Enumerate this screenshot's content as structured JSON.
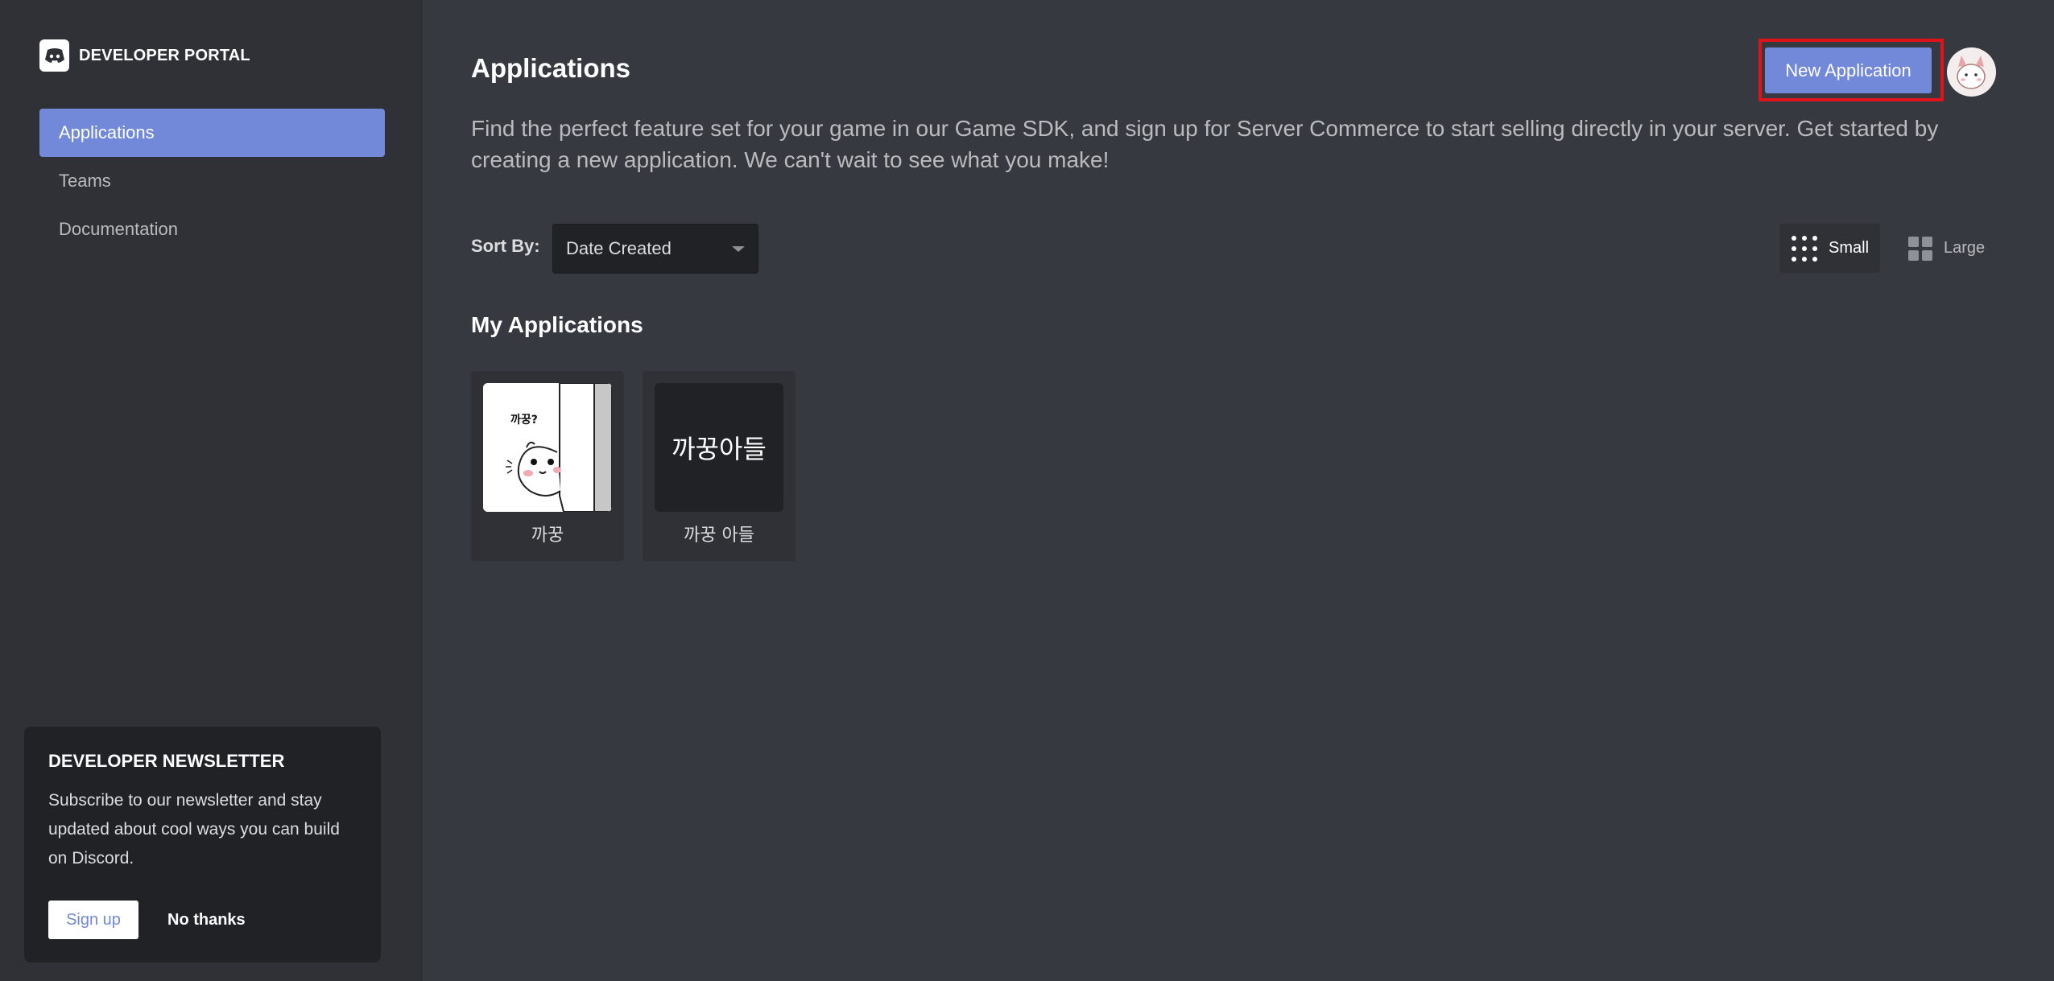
{
  "sidebar": {
    "brand": "DEVELOPER PORTAL",
    "items": [
      {
        "label": "Applications"
      },
      {
        "label": "Teams"
      },
      {
        "label": "Documentation"
      }
    ],
    "newsletter": {
      "title": "DEVELOPER NEWSLETTER",
      "body": "Subscribe to our newsletter and stay updated about cool ways you can build on Discord.",
      "signup_label": "Sign up",
      "nothanks_label": "No thanks"
    }
  },
  "header": {
    "title": "Applications",
    "description": "Find the perfect feature set for your game in our Game SDK, and sign up for Server Commerce to start selling directly in your server. Get started by creating a new application. We can't wait to see what you make!",
    "new_app_label": "New Application"
  },
  "toolbar": {
    "sort_label": "Sort By:",
    "sort_value": "Date Created",
    "view_small_label": "Small",
    "view_large_label": "Large"
  },
  "applications": {
    "section_title": "My Applications",
    "items": [
      {
        "name": "까꿍",
        "thumb_caption": "까꿍?",
        "icon": "peeking-character-image"
      },
      {
        "name": "까꿍 아들",
        "thumb_text": "까꿍아들"
      }
    ]
  },
  "colors": {
    "accent": "#7289da",
    "background": "#36393f",
    "sidebar": "#2f3136",
    "highlight_border": "#e0121a"
  }
}
